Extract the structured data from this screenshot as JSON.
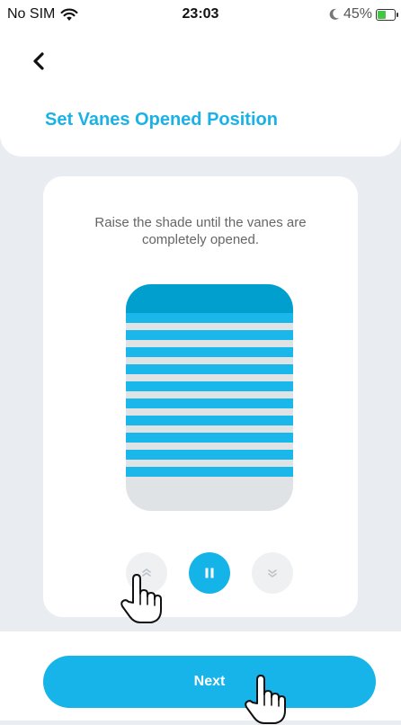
{
  "status_bar": {
    "carrier": "No SIM",
    "time": "23:03",
    "battery_percent": "45%",
    "battery_level": 0.45,
    "icons": [
      "wifi-icon",
      "moon-icon",
      "battery-charging-icon"
    ]
  },
  "header": {
    "back_icon": "chevron-left-icon",
    "title": "Set Vanes Opened Position"
  },
  "content": {
    "instruction": "Raise the shade until the vanes are completely opened.",
    "shade_illustration": {
      "slat_count": 10,
      "colors": {
        "head": "#009fce",
        "slat": "#1ab8ea",
        "background": "#e0e3e5"
      }
    },
    "controls": {
      "up_icon": "chevron-up-icon",
      "pause_icon": "pause-icon",
      "down_icon": "chevron-down-icon"
    }
  },
  "footer": {
    "next_label": "Next"
  },
  "colors": {
    "accent": "#16b4e8",
    "title": "#1ab2e6",
    "page_background": "#e9edf2"
  }
}
